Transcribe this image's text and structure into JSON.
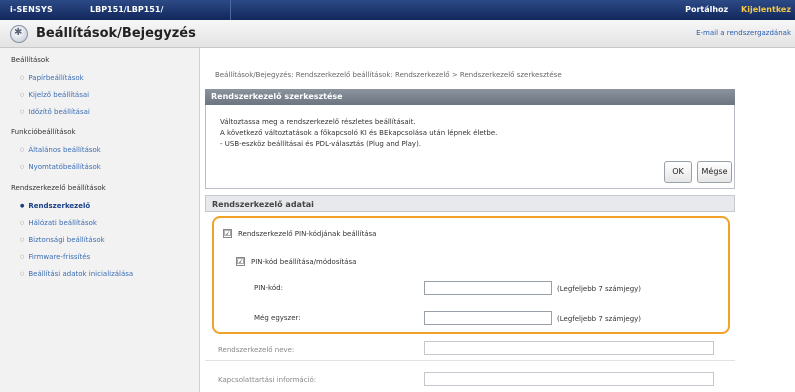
{
  "topbar": {
    "brand": "i-SENSYS",
    "model": "LBP151/LBP151/",
    "link_portal": "Portálhoz",
    "link_logout": "Kijelentkez"
  },
  "titlebar": {
    "title": "Beállítások/Bejegyzés",
    "email_link": "E-mail a rendszergazdának"
  },
  "sidebar": {
    "sections": [
      {
        "label": "Beállítások",
        "items": [
          "Papírbeállítások",
          "Kijelző beállításai",
          "Időzítő beállításai"
        ]
      },
      {
        "label": "Funkcióbeállítások",
        "items": [
          "Általános beállítások",
          "Nyomtatóbeállítások"
        ]
      },
      {
        "label": "Rendszerkezelő beállítások",
        "items": [
          "Rendszerkezelő",
          "Hálózati beállítások",
          "Biztonsági beállítások",
          "Firmware-frissítés",
          "Beállítási adatok inicializálása"
        ]
      }
    ],
    "active_item": "Rendszerkezelő"
  },
  "breadcrumb": "Beállítások/Bejegyzés: Rendszerkezelő beállítások: Rendszerkezelő > Rendszerkezelő szerkesztése",
  "edit_panel": {
    "title": "Rendszerkezelő szerkesztése",
    "lines": [
      "Változtassa meg a rendszerkezelő részletes beállításait.",
      "A következő változtatások a főkapcsoló KI és BEkapcsolása után lépnek életbe.",
      "- USB-eszköz beállításai és PDL-választás (Plug and Play)."
    ],
    "ok_label": "OK",
    "cancel_label": "Mégse"
  },
  "admin_data": {
    "title": "Rendszerkezelő adatai",
    "pin_setting_label": "Rendszerkezelő PIN-kódjának beállítása",
    "pin_setting_checked": "☑",
    "pin_change_label": "PIN-kód beállítása/módosítása",
    "pin_change_checked": "☑",
    "pin_label": "PIN-kód:",
    "pin_value": "",
    "pin_hint": "(Legfeljebb 7 számjegy)",
    "confirm_label": "Még egyszer:",
    "confirm_value": "",
    "confirm_hint": "(Legfeljebb 7 számjegy)",
    "name_label": "Rendszerkezelő neve:",
    "name_value": "",
    "contact_label": "Kapcsolattartási információ:",
    "contact_value": ""
  }
}
